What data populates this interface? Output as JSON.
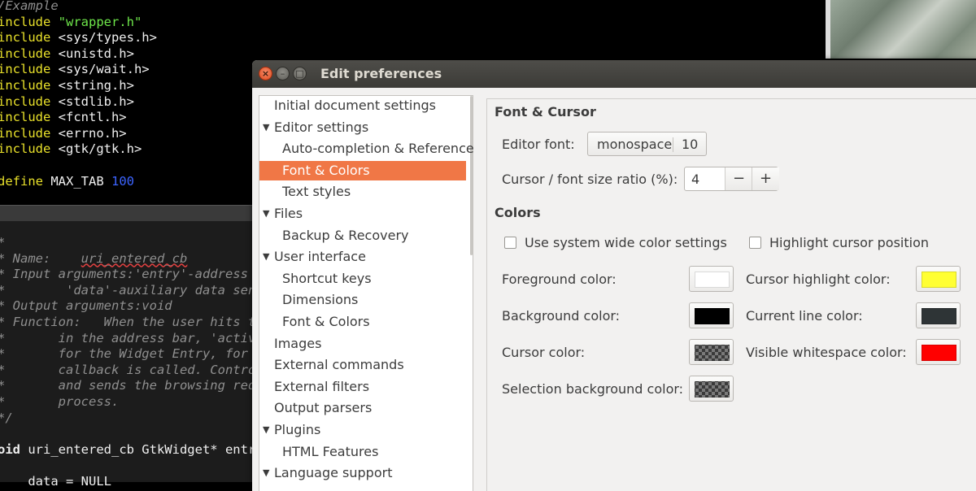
{
  "editor": {
    "top_lines": [
      {
        "a": "/Example",
        "b": ""
      },
      {
        "a": "include ",
        "b": "\"wrapper.h\""
      },
      {
        "a": "include ",
        "b": "<sys/types.h>"
      },
      {
        "a": "include ",
        "b": "<unistd.h>"
      },
      {
        "a": "include ",
        "b": "<sys/wait.h>"
      },
      {
        "a": "include ",
        "b": "<string.h>"
      },
      {
        "a": "include ",
        "b": "<stdlib.h>"
      },
      {
        "a": "include ",
        "b": "<fcntl.h>"
      },
      {
        "a": "include ",
        "b": "<errno.h>"
      },
      {
        "a": "include ",
        "b": "<gtk/gtk.h>"
      },
      {
        "a": "",
        "b": ""
      },
      {
        "a": "define ",
        "b": "MAX_TAB ",
        "c": "100"
      }
    ],
    "bottom_lines": [
      "*",
      "* Name:    ",
      "* Input arguments:'entry'-address",
      "*        'data'-auxiliary data sen",
      "* Output arguments:void",
      "* Function:   When the user hits t",
      "*       in the address bar, 'activ",
      "*       for the Widget Entry, for",
      "*       callback is called. Contro",
      "*       and sends the browsing req",
      "*       process.",
      "*/",
      "",
      "oid uri_entered_cb GtkWidget* entr",
      "",
      "    data = NULL"
    ],
    "func_name": "uri_entered_cb"
  },
  "dialog": {
    "title": "Edit preferences",
    "window_buttons": {
      "close": "×",
      "minimize": "–",
      "maximize": "□"
    }
  },
  "sidebar": {
    "items": [
      {
        "label": "Initial document settings",
        "level": 0,
        "arrow": false,
        "selected": false
      },
      {
        "label": "Editor settings",
        "level": 0,
        "arrow": true,
        "selected": false
      },
      {
        "label": "Auto-completion & Reference",
        "level": 1,
        "arrow": false,
        "selected": false
      },
      {
        "label": "Font & Colors",
        "level": 1,
        "arrow": false,
        "selected": true
      },
      {
        "label": "Text styles",
        "level": 1,
        "arrow": false,
        "selected": false
      },
      {
        "label": "Files",
        "level": 0,
        "arrow": true,
        "selected": false
      },
      {
        "label": "Backup & Recovery",
        "level": 1,
        "arrow": false,
        "selected": false
      },
      {
        "label": "User interface",
        "level": 0,
        "arrow": true,
        "selected": false
      },
      {
        "label": "Shortcut keys",
        "level": 1,
        "arrow": false,
        "selected": false
      },
      {
        "label": "Dimensions",
        "level": 1,
        "arrow": false,
        "selected": false
      },
      {
        "label": "Font & Colors",
        "level": 1,
        "arrow": false,
        "selected": false
      },
      {
        "label": "Images",
        "level": 0,
        "arrow": false,
        "selected": false
      },
      {
        "label": "External commands",
        "level": 0,
        "arrow": false,
        "selected": false
      },
      {
        "label": "External filters",
        "level": 0,
        "arrow": false,
        "selected": false
      },
      {
        "label": "Output parsers",
        "level": 0,
        "arrow": false,
        "selected": false
      },
      {
        "label": "Plugins",
        "level": 0,
        "arrow": true,
        "selected": false
      },
      {
        "label": "HTML Features",
        "level": 1,
        "arrow": false,
        "selected": false
      },
      {
        "label": "Language support",
        "level": 0,
        "arrow": true,
        "selected": false
      }
    ],
    "arrow_glyph": "▼"
  },
  "content": {
    "font_section": "Font & Cursor",
    "editor_font_label": "Editor font:",
    "editor_font_name": "monospace",
    "editor_font_size": "10",
    "cursor_ratio_label": "Cursor / font size ratio (%):",
    "cursor_ratio_value": "4",
    "minus": "−",
    "plus": "+",
    "colors_section": "Colors",
    "use_system_colors": "Use system wide color settings",
    "highlight_cursor": "Highlight cursor position",
    "color_rows": [
      {
        "left_label": "Foreground color:",
        "left_color": "#ffffff",
        "right_label": "Cursor highlight color:",
        "right_color": "#ffff33"
      },
      {
        "left_label": "Background color:",
        "left_color": "#000000",
        "right_label": "Current line color:",
        "right_color": "#2e3436"
      },
      {
        "left_label": "Cursor color:",
        "left_color": "checker",
        "right_label": "Visible whitespace color:",
        "right_color": "#ff0000"
      },
      {
        "left_label": "Selection background color:",
        "left_color": "checker",
        "right_label": "",
        "right_color": ""
      }
    ]
  }
}
